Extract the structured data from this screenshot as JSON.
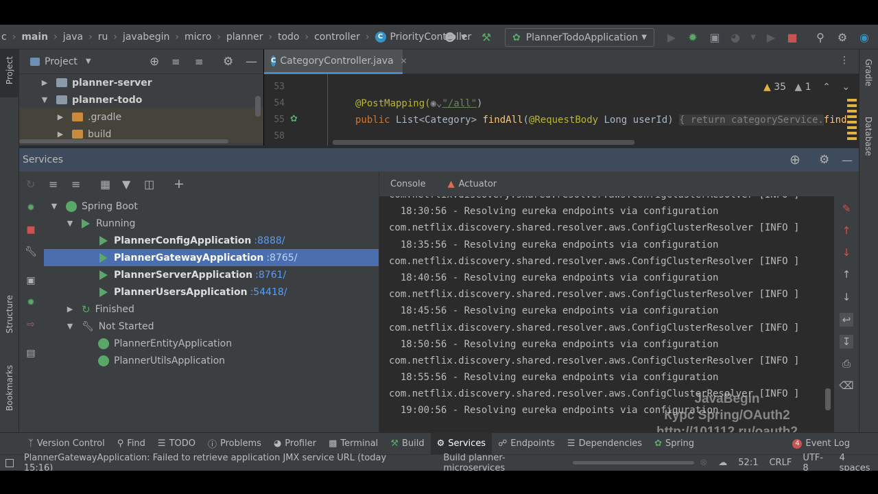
{
  "breadcrumbs": [
    "c",
    "main",
    "java",
    "ru",
    "javabegin",
    "micro",
    "planner",
    "todo",
    "controller",
    "PriorityController"
  ],
  "run_config": "PlannerTodoApplication",
  "project_panel": {
    "title": "Project",
    "tree": [
      {
        "label": "planner-server",
        "bold": true
      },
      {
        "label": "planner-todo",
        "bold": true
      },
      {
        "label": ".gradle",
        "bold": false
      },
      {
        "label": "build",
        "bold": false
      }
    ]
  },
  "editor": {
    "tab": "CategoryController.java",
    "warnings": "35",
    "weak_warnings": "1",
    "lines": [
      {
        "num": "53"
      },
      {
        "num": "54"
      },
      {
        "num": "55"
      },
      {
        "num": "58"
      }
    ],
    "code": {
      "l54_annotation": "@PostMapping(",
      "l54_param": "\"/all\"",
      "l54_close": ")",
      "l55_public": "public ",
      "l55_type": "List<Category> ",
      "l55_method": "findAll",
      "l55_args_open": "(",
      "l55_annotation": "@RequestBody",
      "l55_args": " Long userId) ",
      "l55_fold": "{ return categoryService.",
      "l55_tail": "find"
    }
  },
  "services": {
    "title": "Services",
    "tree": {
      "spring_boot": "Spring Boot",
      "running": "Running",
      "apps_running": [
        {
          "name": "PlannerConfigApplication",
          "port": ":8888/"
        },
        {
          "name": "PlannerGatewayApplication",
          "port": ":8765/"
        },
        {
          "name": "PlannerServerApplication",
          "port": ":8761/"
        },
        {
          "name": "PlannerUsersApplication",
          "port": ":54418/"
        }
      ],
      "finished": "Finished",
      "not_started": "Not Started",
      "apps_not_started": [
        "PlannerEntityApplication",
        "PlannerUtilsApplication"
      ]
    },
    "console_tabs": [
      "Console",
      "Actuator"
    ],
    "log_lines": [
      "com.netflix.discovery.shared.resolver.aws.ConfigClusterResolver [INFO ]",
      "  18:30:56 - Resolving eureka endpoints via configuration",
      "com.netflix.discovery.shared.resolver.aws.ConfigClusterResolver [INFO ]",
      "  18:35:56 - Resolving eureka endpoints via configuration",
      "com.netflix.discovery.shared.resolver.aws.ConfigClusterResolver [INFO ]",
      "  18:40:56 - Resolving eureka endpoints via configuration",
      "com.netflix.discovery.shared.resolver.aws.ConfigClusterResolver [INFO ]",
      "  18:45:56 - Resolving eureka endpoints via configuration",
      "com.netflix.discovery.shared.resolver.aws.ConfigClusterResolver [INFO ]",
      "  18:50:56 - Resolving eureka endpoints via configuration",
      "com.netflix.discovery.shared.resolver.aws.ConfigClusterResolver [INFO ]",
      "  18:55:56 - Resolving eureka endpoints via configuration",
      "com.netflix.discovery.shared.resolver.aws.ConfigClusterResolver [INFO ]",
      "  19:00:56 - Resolving eureka endpoints via configuration"
    ]
  },
  "watermark": [
    "JavaBegin",
    "Курс Spring/OAuth2",
    "http://101112.ru/oauth2"
  ],
  "left_strip": {
    "project": "Project",
    "structure": "Structure",
    "bookmarks": "Bookmarks"
  },
  "right_strip": {
    "gradle": "Gradle",
    "database": "Database"
  },
  "bottom_tools": [
    {
      "label": "Version Control",
      "icon": "branch-icon"
    },
    {
      "label": "Find",
      "icon": "search-icon"
    },
    {
      "label": "TODO",
      "icon": "list-icon"
    },
    {
      "label": "Problems",
      "icon": "info-icon"
    },
    {
      "label": "Profiler",
      "icon": "profiler-icon"
    },
    {
      "label": "Terminal",
      "icon": "terminal-icon"
    },
    {
      "label": "Build",
      "icon": "hammer-icon"
    },
    {
      "label": "Services",
      "icon": "services-icon"
    },
    {
      "label": "Endpoints",
      "icon": "endpoints-icon"
    },
    {
      "label": "Dependencies",
      "icon": "layers-icon"
    },
    {
      "label": "Spring",
      "icon": "spring-icon"
    }
  ],
  "event_log": {
    "count": "4",
    "label": "Event Log"
  },
  "status": {
    "message": "PlannerGatewayApplication: Failed to retrieve application JMX service URL (today 15:16)",
    "task": "Build planner-microservices",
    "position": "52:1",
    "line_sep": "CRLF",
    "encoding": "UTF-8",
    "indent": "4 spaces"
  },
  "colors": {
    "accent": "#4b6eaf",
    "run_green": "#59a869",
    "stop_red": "#c75450",
    "link_blue": "#589df6"
  }
}
